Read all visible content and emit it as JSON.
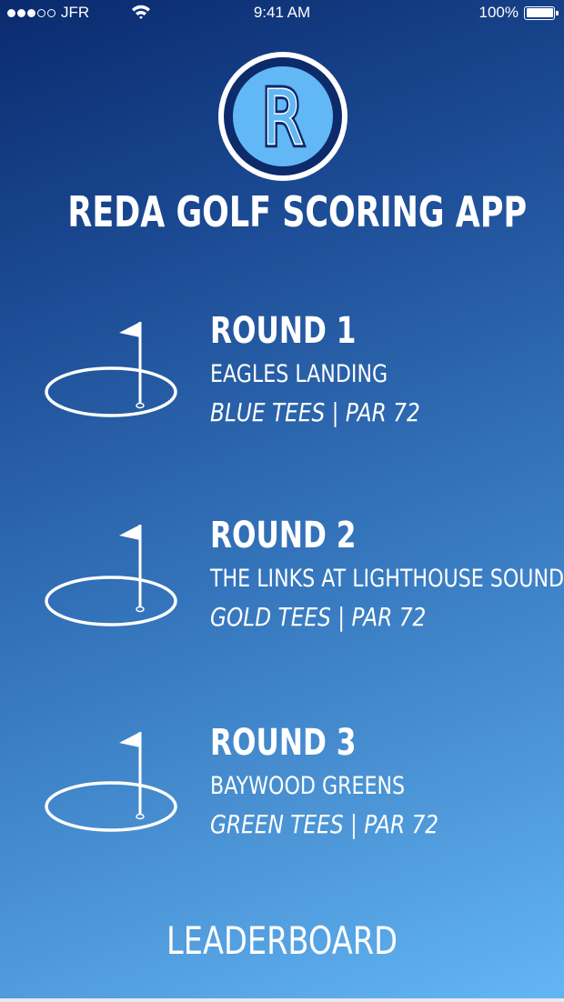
{
  "status_bar": {
    "carrier": "JFR",
    "time": "9:41 AM",
    "battery": "100%",
    "signal_strength": 3,
    "signal_total": 5
  },
  "logo": {
    "letter": "R"
  },
  "title": "REDA GOLF SCORING APP",
  "rounds": [
    {
      "title": "ROUND 1",
      "course": "EAGLES LANDING",
      "tees": "BLUE TEES | PAR 72"
    },
    {
      "title": "ROUND 2",
      "course": "THE LINKS AT LIGHTHOUSE SOUND",
      "tees": "GOLD TEES | PAR 72"
    },
    {
      "title": "ROUND 3",
      "course": "BAYWOOD GREENS",
      "tees": "GREEN TEES | PAR 72"
    }
  ],
  "leaderboard_label": "LEADERBOARD",
  "colors": {
    "logo_ring": "#0d2a6b",
    "logo_fill": "#62b8f5",
    "background_top": "#0a2a6e",
    "background_bottom": "#63b6f5"
  }
}
